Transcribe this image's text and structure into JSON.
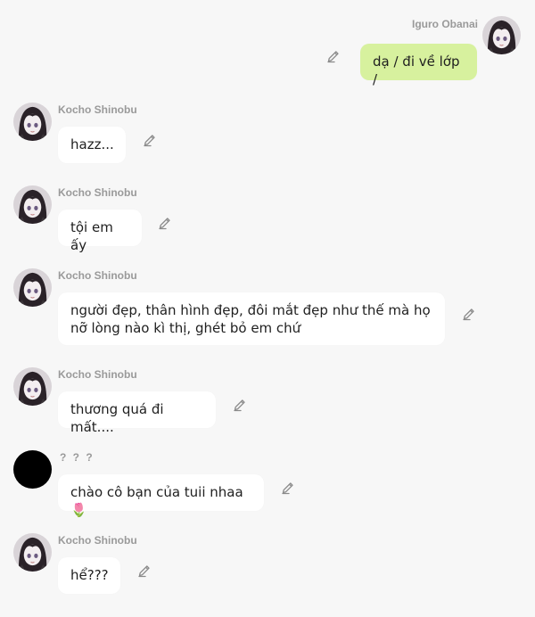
{
  "conversation": {
    "messages": [
      {
        "sender": "Iguro Obanai",
        "text": "dạ / đi về lớp /",
        "avatar_icon": "anime-character-avatar-icon",
        "side": "right"
      },
      {
        "sender": "Kocho Shinobu",
        "text": "hazz...",
        "avatar_icon": "anime-character-avatar-icon",
        "side": "left"
      },
      {
        "sender": "Kocho Shinobu",
        "text": "tội em ấy",
        "avatar_icon": "anime-character-avatar-icon",
        "side": "left"
      },
      {
        "sender": "Kocho Shinobu",
        "text": "người đẹp, thân hình đẹp, đôi mắt đẹp như thế mà họ nỡ lòng nào kì thị, ghét bỏ em chứ",
        "avatar_icon": "anime-character-avatar-icon",
        "side": "left"
      },
      {
        "sender": "Kocho Shinobu",
        "text": "thương quá đi mất....",
        "avatar_icon": "anime-character-avatar-icon",
        "side": "left"
      },
      {
        "sender": "? ? ?",
        "text": "chào cô bạn của tuii nhaa 🌷",
        "avatar_icon": "black-circle-avatar",
        "side": "left"
      },
      {
        "sender": "Kocho Shinobu",
        "text": "hể???",
        "avatar_icon": "anime-character-avatar-icon",
        "side": "left"
      }
    ]
  },
  "colors": {
    "background": "#f7f7f7",
    "my_bubble": "#d7f19e",
    "other_bubble": "#ffffff",
    "sender_name": "#9a9a9a"
  },
  "icons": {
    "edit": "pencil-edit-icon"
  }
}
